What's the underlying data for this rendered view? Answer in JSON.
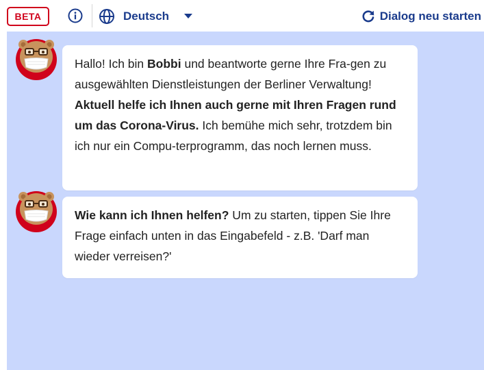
{
  "header": {
    "beta_label": "BETA",
    "language_label": "Deutsch",
    "restart_label": "Dialog neu starten",
    "accent_color": "#1a3b8c",
    "beta_color": "#d0021b"
  },
  "chat": {
    "background_color": "#c9d7fd",
    "messages": [
      {
        "sender": "Bobbi",
        "parts": {
          "p1": "Hallo! Ich bin ",
          "p2": "Bobbi",
          "p3": " und beantworte gerne Ihre Fra-gen zu ausgewählten Dienstleistungen der Berliner Verwaltung! ",
          "p4": "Aktuell helfe ich Ihnen auch gerne mit Ihren Fragen rund um das Corona-Virus.",
          "p5": " Ich bemühe mich sehr, trotzdem bin ich nur ein Compu-terprogramm, das noch lernen muss."
        }
      },
      {
        "sender": "Bobbi",
        "parts": {
          "p1": "Wie kann ich Ihnen helfen?",
          "p2": " Um zu starten, tippen Sie Ihre Frage einfach unten in das Eingabefeld - z.B. 'Darf man wieder verreisen?'"
        }
      }
    ]
  }
}
